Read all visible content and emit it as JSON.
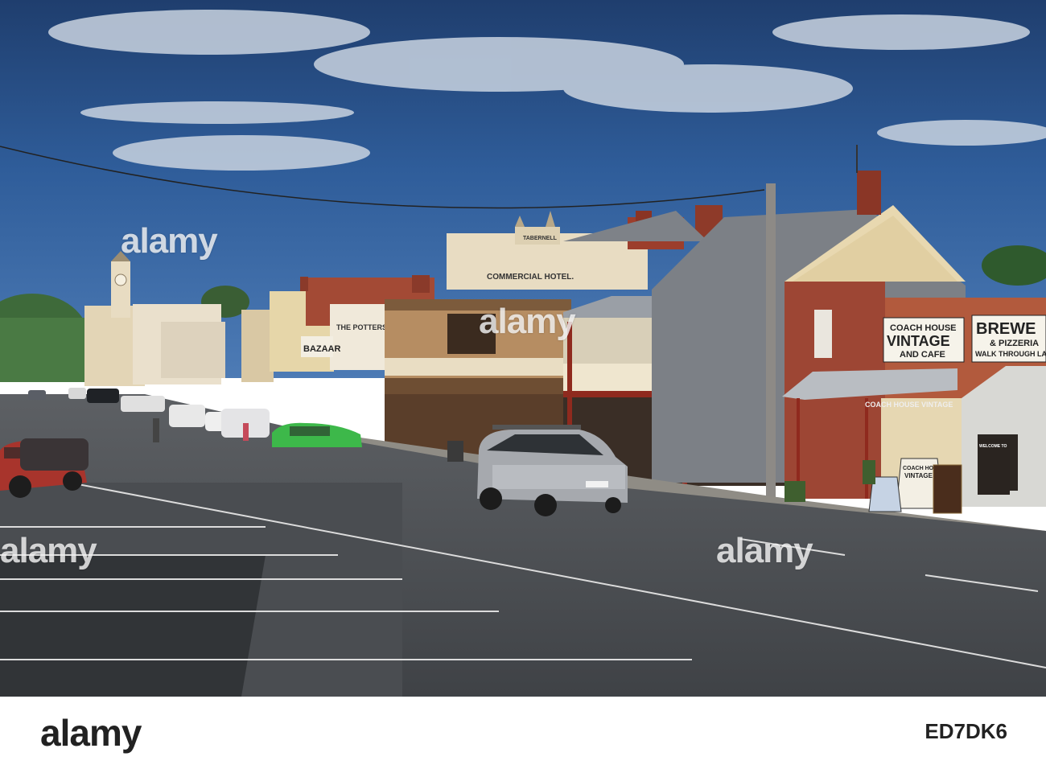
{
  "signs": {
    "coach_house_line1": "COACH HOUSE",
    "coach_house_line2": "VINTAGE",
    "coach_house_line3": "AND CAFE",
    "brewery_line1": "BREWE",
    "brewery_line2": "& PIZZERIA",
    "brewery_line3": "WALK THROUGH LAN",
    "commercial_hotel": "COMMERCIAL HOTEL.",
    "tabernell": "TABERNELL",
    "bazaar": "BAZAAR",
    "the_potters": "THE POTTERS",
    "verandah_sign": "COACH HOUSE VINTAGE",
    "aframe_line1": "COACH HOUSE",
    "aframe_line2": "VINTAGE",
    "board_welcome": "WELCOME TO"
  },
  "watermark": {
    "text": "alamy"
  },
  "footer": {
    "logo": "alamy",
    "image_id": "ED7DK6"
  }
}
